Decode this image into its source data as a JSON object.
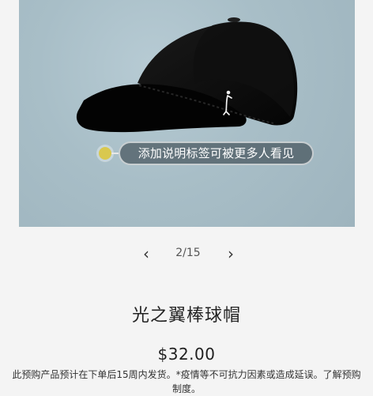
{
  "product": {
    "photo_alt": "black baseball cap on blue background",
    "image_counter": "2/15",
    "title": "光之翼棒球帽",
    "price": "$32.00",
    "note": "此预购产品预计在下单后15周内发货。*疫情等不可抗力因素或造成延误。了解预购制度。"
  },
  "tag": {
    "label": "添加说明标签可被更多人看见"
  },
  "pager": {
    "prev_icon": "chevron-left-icon",
    "next_icon": "chevron-right-icon"
  },
  "colors": {
    "photo_bg": "#a8bec7",
    "tag_dot": "#d9c84f",
    "text": "#222222"
  }
}
